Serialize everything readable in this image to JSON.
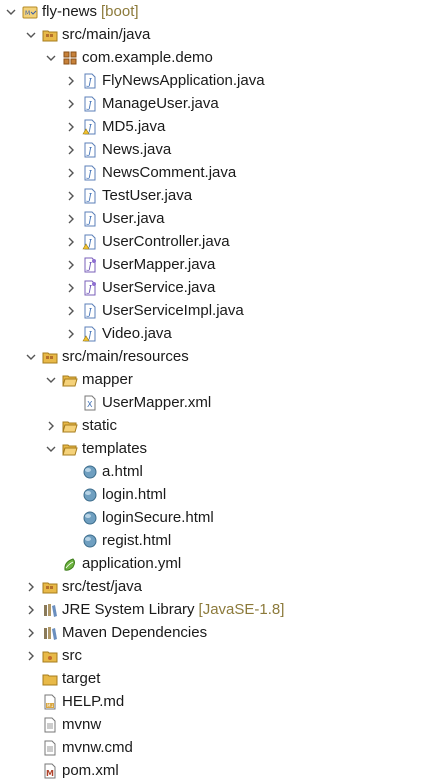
{
  "project": {
    "name": "fly-news",
    "decoration": "[boot]"
  },
  "src_main_java": {
    "label": "src/main/java",
    "package": "com.example.demo",
    "files": [
      "FlyNewsApplication.java",
      "ManageUser.java",
      "MD5.java",
      "News.java",
      "NewsComment.java",
      "TestUser.java",
      "User.java",
      "UserController.java",
      "UserMapper.java",
      "UserService.java",
      "UserServiceImpl.java",
      "Video.java"
    ]
  },
  "src_main_resources": {
    "label": "src/main/resources",
    "mapper_folder": "mapper",
    "mapper_file": "UserMapper.xml",
    "static_folder": "static",
    "templates_folder": "templates",
    "templates": [
      "a.html",
      "login.html",
      "loginSecure.html",
      "regist.html"
    ],
    "config_file": "application.yml"
  },
  "src_test_java": {
    "label": "src/test/java"
  },
  "jre": {
    "label": "JRE System Library",
    "decoration": "[JavaSE-1.8]"
  },
  "maven": {
    "label": "Maven Dependencies"
  },
  "root_items": {
    "src": "src",
    "target": "target",
    "help": "HELP.md",
    "mvnw": "mvnw",
    "mvnw_cmd": "mvnw.cmd",
    "pom": "pom.xml"
  },
  "colors": {
    "decoration": "#8c7a3b",
    "folder": "#e8b948",
    "package": "#b5702b",
    "java": "#3f6fb5",
    "html_globe": "#5a8fb0"
  }
}
